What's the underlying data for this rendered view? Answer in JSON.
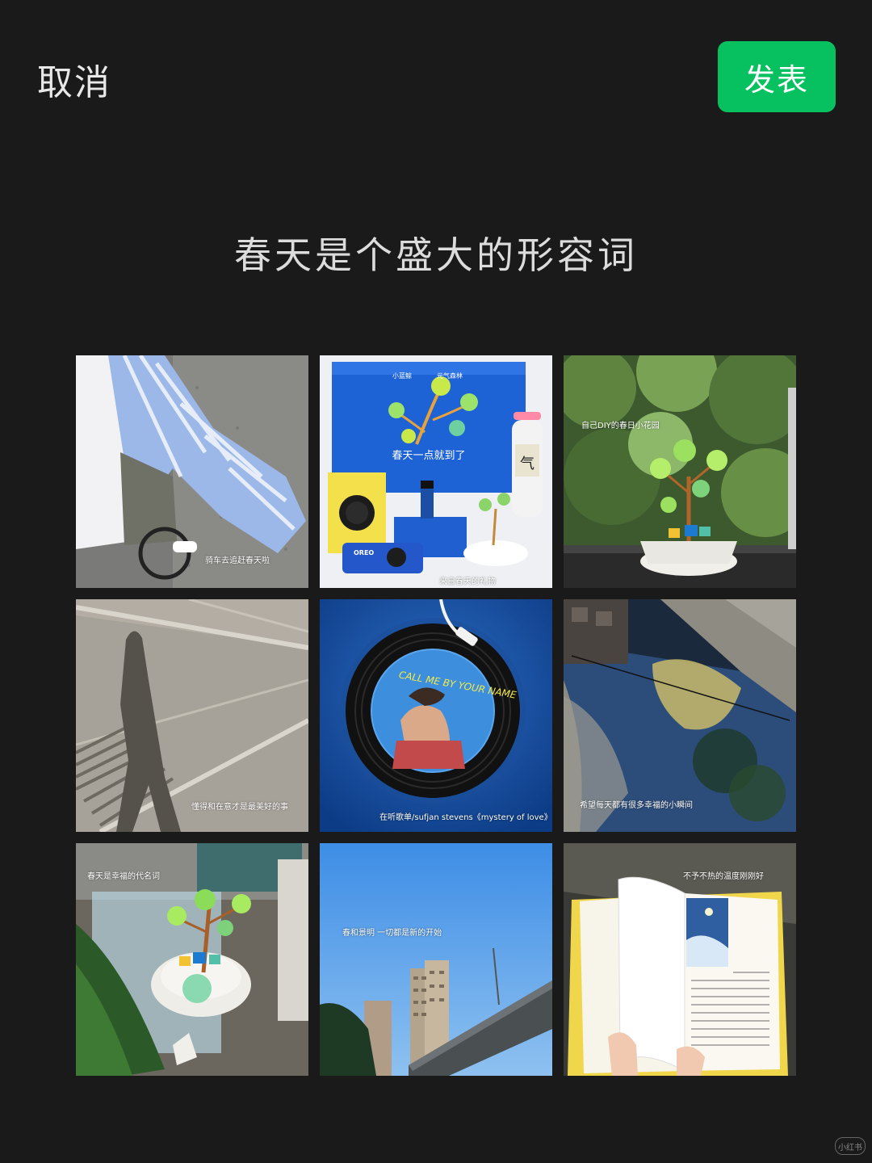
{
  "header": {
    "cancel_label": "取消",
    "publish_label": "发表",
    "publish_color": "#07c160"
  },
  "post": {
    "caption": "春天是个盛大的形容词"
  },
  "grid": {
    "photos": [
      {
        "caption": "骑车去追赶春天啦"
      },
      {
        "caption": "来自春天的礼物",
        "box_text": "春天一点就到了",
        "brand_a": "小蓝鲸",
        "brand_b": "元气森林",
        "bottle_label": "气",
        "cookie_brand": "OREO"
      },
      {
        "caption": "自己DIY的春日小花园"
      },
      {
        "caption": "懂得和在意才是最美好的事"
      },
      {
        "caption": "在听歌单/sufjan stevens《mystery of love》",
        "album_text": "CALL ME BY YOUR NAME"
      },
      {
        "caption": "希望每天都有很多幸福的小瞬间"
      },
      {
        "caption": "春天是幸福的代名词"
      },
      {
        "caption": "春和景明 一切都是新的开始"
      },
      {
        "caption": "不予不热的温度刚刚好"
      }
    ]
  },
  "watermark": "小红书"
}
